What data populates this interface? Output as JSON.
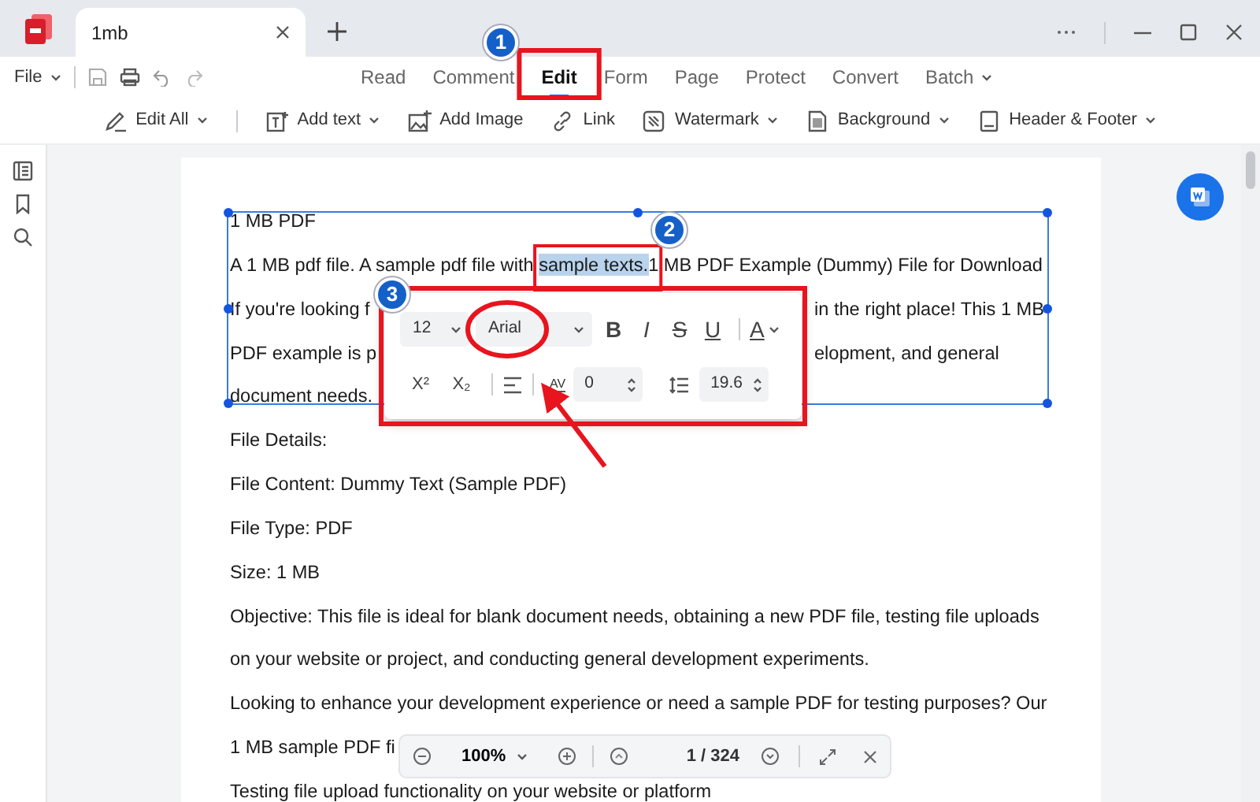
{
  "window": {
    "tab_title": "1mb"
  },
  "menu": {
    "file": "File",
    "tabs": [
      {
        "label": "Read",
        "selected": false,
        "dropdown": false
      },
      {
        "label": "Comment",
        "selected": false,
        "dropdown": false
      },
      {
        "label": "Edit",
        "selected": true,
        "dropdown": false
      },
      {
        "label": "Form",
        "selected": false,
        "dropdown": false
      },
      {
        "label": "Page",
        "selected": false,
        "dropdown": false
      },
      {
        "label": "Protect",
        "selected": false,
        "dropdown": false
      },
      {
        "label": "Convert",
        "selected": false,
        "dropdown": false
      },
      {
        "label": "Batch",
        "selected": false,
        "dropdown": true
      }
    ]
  },
  "toolbar": [
    {
      "kind": "edit",
      "label": "Edit All",
      "dropdown": true,
      "separator_after": true
    },
    {
      "kind": "text",
      "label": "Add text",
      "dropdown": true,
      "separator_after": false
    },
    {
      "kind": "image",
      "label": "Add Image",
      "dropdown": false,
      "separator_after": false
    },
    {
      "kind": "link",
      "label": "Link",
      "dropdown": false,
      "separator_after": false
    },
    {
      "kind": "watermark",
      "label": "Watermark",
      "dropdown": true,
      "separator_after": false
    },
    {
      "kind": "background",
      "label": "Background",
      "dropdown": true,
      "separator_after": false
    },
    {
      "kind": "header",
      "label": "Header & Footer",
      "dropdown": true,
      "separator_after": false
    }
  ],
  "document": {
    "lines": [
      {
        "parts": [
          {
            "text": "1 MB PDF",
            "selected": false
          }
        ]
      },
      {
        "parts": [
          {
            "text": "A 1 MB pdf file. A sample pdf file with ",
            "selected": false
          },
          {
            "text": "sample texts.",
            "selected": true
          },
          {
            "text": "1 MB PDF Example (Dummy) File for Download",
            "selected": false
          }
        ]
      },
      {
        "parts": [
          {
            "text": "If you're looking f",
            "selected": false
          }
        ],
        "tail": "in the right place! This 1 MB"
      },
      {
        "parts": [
          {
            "text": "PDF example is p",
            "selected": false
          }
        ],
        "tail": "elopment, and general"
      },
      {
        "parts": [
          {
            "text": "document needs.",
            "selected": false
          }
        ]
      },
      {
        "parts": [
          {
            "text": "File Details:",
            "selected": false
          }
        ]
      },
      {
        "parts": [
          {
            "text": "File Content: Dummy Text (Sample PDF)",
            "selected": false
          }
        ]
      },
      {
        "parts": [
          {
            "text": "File Type: PDF",
            "selected": false
          }
        ]
      },
      {
        "parts": [
          {
            "text": "Size: 1 MB",
            "selected": false
          }
        ]
      },
      {
        "parts": [
          {
            "text": "Objective: This file is ideal for blank document needs, obtaining a new PDF file, testing file uploads",
            "selected": false
          }
        ]
      },
      {
        "parts": [
          {
            "text": "on your website or project, and conducting general development experiments.",
            "selected": false
          }
        ]
      },
      {
        "parts": [
          {
            "text": "Looking to enhance your development experience or need a sample PDF for testing purposes? Our",
            "selected": false
          }
        ]
      },
      {
        "parts": [
          {
            "text": "1 MB sample PDF fi",
            "selected": false
          }
        ]
      },
      {
        "parts": [
          {
            "text": "Testing file upload functionality on your website or platform",
            "selected": false
          }
        ]
      }
    ]
  },
  "format_popup": {
    "font_size": "12",
    "font": "Arial",
    "style_buttons": [
      "B",
      "I",
      "S",
      "U"
    ],
    "color_button": "A",
    "superscript": "X²",
    "subscript": "X₂",
    "spacing_label": "AV",
    "char_spacing": "0",
    "line_spacing": "19.6"
  },
  "bottom_bar": {
    "zoom": "100%",
    "page": "1 / 324"
  },
  "callouts": [
    {
      "number": "1"
    },
    {
      "number": "2"
    },
    {
      "number": "3"
    }
  ]
}
